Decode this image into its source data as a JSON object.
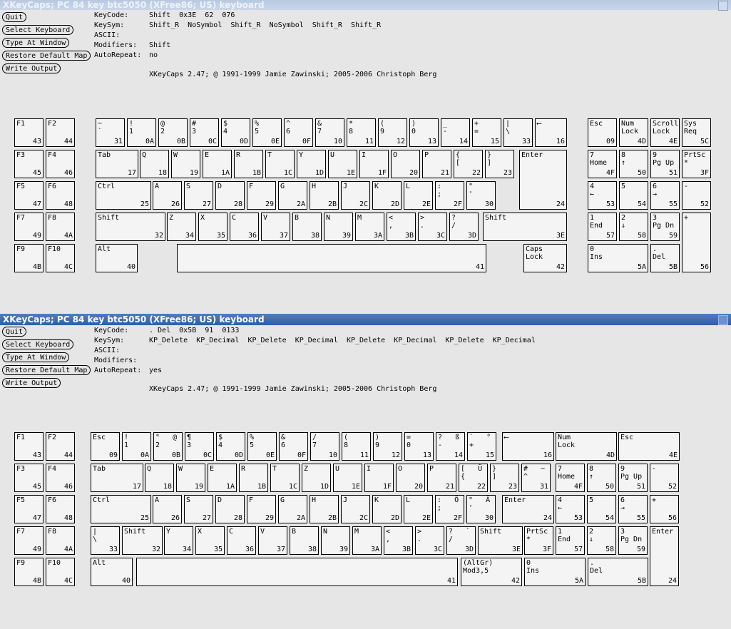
{
  "window1": {
    "title": "XKeyCaps; PC 84 key btc5050 (XFree86; US) keyboard",
    "buttons": [
      "Quit",
      "Select Keyboard",
      "Type At Window",
      "Restore Default Map",
      "Write Output"
    ],
    "info": {
      "keycode_label": "KeyCode:",
      "keycode_value": "Shift  0x3E  62  076",
      "keysym_label": "KeySym:",
      "keysym_value": "Shift_R  NoSymbol  Shift_R  NoSymbol  Shift_R  Shift_R",
      "ascii_label": "ASCII:",
      "ascii_value": "",
      "modifiers_label": "Modifiers:",
      "modifiers_value": "Shift",
      "autorepeat_label": "AutoRepeat:",
      "autorepeat_value": "no"
    },
    "copyright": "XKeyCaps 2.47; @ 1991-1999 Jamie Zawinski; 2005-2006 Christoph Berg",
    "keys": [
      {
        "t": "F1",
        "c": "43"
      },
      {
        "t": "F2",
        "c": "44"
      },
      {
        "t": "F3",
        "c": "45"
      },
      {
        "t": "F4",
        "c": "46"
      },
      {
        "t": "F5",
        "c": "47"
      },
      {
        "t": "F6",
        "c": "48"
      },
      {
        "t": "F7",
        "c": "49"
      },
      {
        "t": "F8",
        "c": "4A"
      },
      {
        "t": "F9",
        "c": "4B"
      },
      {
        "t": "F10",
        "c": "4C"
      },
      {
        "t": "~\n`",
        "c": "31"
      },
      {
        "t": "!\n1",
        "c": "0A"
      },
      {
        "t": "@\n2",
        "c": "0B"
      },
      {
        "t": "#\n3",
        "c": "0C"
      },
      {
        "t": "$\n4",
        "c": "0D"
      },
      {
        "t": "%\n5",
        "c": "0E"
      },
      {
        "t": "^\n6",
        "c": "0F"
      },
      {
        "t": "&\n7",
        "c": "10"
      },
      {
        "t": "*\n8",
        "c": "11"
      },
      {
        "t": "(\n9",
        "c": "12"
      },
      {
        "t": ")\n0",
        "c": "13"
      },
      {
        "t": "_\n-",
        "c": "14"
      },
      {
        "t": "+\n=",
        "c": "15"
      },
      {
        "t": "|\n\\",
        "c": "33"
      },
      {
        "t": "⟵",
        "c": "16"
      },
      {
        "t": "Tab",
        "c": "17"
      },
      {
        "t": "Q",
        "c": "18"
      },
      {
        "t": "W",
        "c": "19"
      },
      {
        "t": "E",
        "c": "1A"
      },
      {
        "t": "R",
        "c": "1B"
      },
      {
        "t": "T",
        "c": "1C"
      },
      {
        "t": "Y",
        "c": "1D"
      },
      {
        "t": "U",
        "c": "1E"
      },
      {
        "t": "I",
        "c": "1F"
      },
      {
        "t": "O",
        "c": "20"
      },
      {
        "t": "P",
        "c": "21"
      },
      {
        "t": "{\n[",
        "c": "22"
      },
      {
        "t": "}\n]",
        "c": "23"
      },
      {
        "t": "Enter",
        "c": "24"
      },
      {
        "t": "Ctrl",
        "c": "25"
      },
      {
        "t": "A",
        "c": "26"
      },
      {
        "t": "S",
        "c": "27"
      },
      {
        "t": "D",
        "c": "28"
      },
      {
        "t": "F",
        "c": "29"
      },
      {
        "t": "G",
        "c": "2A"
      },
      {
        "t": "H",
        "c": "2B"
      },
      {
        "t": "J",
        "c": "2C"
      },
      {
        "t": "K",
        "c": "2D"
      },
      {
        "t": "L",
        "c": "2E"
      },
      {
        "t": ":\n;",
        "c": "2F"
      },
      {
        "t": "\"\n'",
        "c": "30"
      },
      {
        "t": "Shift",
        "c": "32"
      },
      {
        "t": "Z",
        "c": "34"
      },
      {
        "t": "X",
        "c": "35"
      },
      {
        "t": "C",
        "c": "36"
      },
      {
        "t": "V",
        "c": "37"
      },
      {
        "t": "B",
        "c": "38"
      },
      {
        "t": "N",
        "c": "39"
      },
      {
        "t": "M",
        "c": "3A"
      },
      {
        "t": "<\n,",
        "c": "3B"
      },
      {
        "t": ">\n.",
        "c": "3C"
      },
      {
        "t": "?\n/",
        "c": "3D"
      },
      {
        "t": "Shift",
        "c": "3E"
      },
      {
        "t": "Alt",
        "c": "40"
      },
      {
        "t": "",
        "c": "41"
      },
      {
        "t": "Caps\nLock",
        "c": "42"
      },
      {
        "t": "Esc",
        "c": "09"
      },
      {
        "t": "Num\nLock",
        "c": "4D"
      },
      {
        "t": "Scroll\nLock",
        "c": "4E"
      },
      {
        "t": "Sys\nReq",
        "c": "5C"
      },
      {
        "t": "7\nHome",
        "c": "4F"
      },
      {
        "t": "8\n↑",
        "c": "50"
      },
      {
        "t": "9\nPg Up",
        "c": "51"
      },
      {
        "t": "PrtSc\n*",
        "c": "3F"
      },
      {
        "t": "4\n←",
        "c": "53"
      },
      {
        "t": "5",
        "c": "54"
      },
      {
        "t": "6\n→",
        "c": "55"
      },
      {
        "t": "-",
        "c": "52"
      },
      {
        "t": "1\nEnd",
        "c": "57"
      },
      {
        "t": "2\n↓",
        "c": "58"
      },
      {
        "t": "3\nPg Dn",
        "c": "59"
      },
      {
        "t": "+",
        "c": "56"
      },
      {
        "t": "0\nIns",
        "c": "5A"
      },
      {
        "t": ".\nDel",
        "c": "5B"
      }
    ]
  },
  "window2": {
    "title": "XKeyCaps; PC 84 key btc5050 (XFree86; US) keyboard",
    "buttons": [
      "Quit",
      "Select Keyboard",
      "Type At Window",
      "Restore Default Map",
      "Write Output"
    ],
    "info": {
      "keycode_label": "KeyCode:",
      "keycode_value": ". Del  0x5B  91  0133",
      "keysym_label": "KeySym:",
      "keysym_value": "KP_Delete  KP_Decimal  KP_Delete  KP_Decimal  KP_Delete  KP_Decimal  KP_Delete  KP_Decimal",
      "ascii_label": "ASCII:",
      "ascii_value": "",
      "modifiers_label": "Modifiers:",
      "modifiers_value": "",
      "autorepeat_label": "AutoRepeat:",
      "autorepeat_value": "yes"
    },
    "copyright": "XKeyCaps 2.47; @ 1991-1999 Jamie Zawinski; 2005-2006 Christoph Berg",
    "keys": [
      {
        "t": "F1",
        "c": "43"
      },
      {
        "t": "F2",
        "c": "44"
      },
      {
        "t": "F3",
        "c": "45"
      },
      {
        "t": "F4",
        "c": "46"
      },
      {
        "t": "F5",
        "c": "47"
      },
      {
        "t": "F6",
        "c": "48"
      },
      {
        "t": "F7",
        "c": "49"
      },
      {
        "t": "F8",
        "c": "4A"
      },
      {
        "t": "F9",
        "c": "4B"
      },
      {
        "t": "F10",
        "c": "4C"
      },
      {
        "t": "Esc",
        "c": "09"
      },
      {
        "t": "!\n1",
        "c": "0A"
      },
      {
        "t": "\"   @\n2",
        "c": "0B"
      },
      {
        "t": "¶\n3",
        "c": "0C"
      },
      {
        "t": "$\n4",
        "c": "0D"
      },
      {
        "t": "%\n5",
        "c": "0E"
      },
      {
        "t": "&\n6",
        "c": "0F"
      },
      {
        "t": "/\n7",
        "c": "10"
      },
      {
        "t": "(\n8",
        "c": "11"
      },
      {
        "t": ")\n9",
        "c": "12"
      },
      {
        "t": "=\n0",
        "c": "13"
      },
      {
        "t": "?   ß\n-",
        "c": "14"
      },
      {
        "t": "`   °\n+",
        "c": "15"
      },
      {
        "t": "⟵",
        "c": "16"
      },
      {
        "t": "Num\nLock",
        "c": "4D"
      },
      {
        "t": "Esc",
        "c": "4E"
      },
      {
        "t": "Tab",
        "c": "17"
      },
      {
        "t": "Q",
        "c": "18"
      },
      {
        "t": "W",
        "c": "19"
      },
      {
        "t": "E",
        "c": "1A"
      },
      {
        "t": "R",
        "c": "1B"
      },
      {
        "t": "T",
        "c": "1C"
      },
      {
        "t": "Z",
        "c": "1D"
      },
      {
        "t": "U",
        "c": "1E"
      },
      {
        "t": "I",
        "c": "1F"
      },
      {
        "t": "O",
        "c": "20"
      },
      {
        "t": "P",
        "c": "21"
      },
      {
        "t": "[   Ü\n{",
        "c": "22"
      },
      {
        "t": "}\n]",
        "c": "23"
      },
      {
        "t": "#   ~\n^",
        "c": "31"
      },
      {
        "t": "7\nHome",
        "c": "4F"
      },
      {
        "t": "8\n↑",
        "c": "50"
      },
      {
        "t": "9\nPg Up",
        "c": "51"
      },
      {
        "t": "-",
        "c": "52"
      },
      {
        "t": "Ctrl",
        "c": "25"
      },
      {
        "t": "A",
        "c": "26"
      },
      {
        "t": "S",
        "c": "27"
      },
      {
        "t": "D",
        "c": "28"
      },
      {
        "t": "F",
        "c": "29"
      },
      {
        "t": "G",
        "c": "2A"
      },
      {
        "t": "H",
        "c": "2B"
      },
      {
        "t": "J",
        "c": "2C"
      },
      {
        "t": "K",
        "c": "2D"
      },
      {
        "t": "L",
        "c": "2E"
      },
      {
        "t": ":   Ö\n;",
        "c": "2F"
      },
      {
        "t": "\"   Ä\n'",
        "c": "30"
      },
      {
        "t": "Enter",
        "c": "24"
      },
      {
        "t": "4\n←",
        "c": "53"
      },
      {
        "t": "5",
        "c": "54"
      },
      {
        "t": "6\n→",
        "c": "55"
      },
      {
        "t": "+",
        "c": "56"
      },
      {
        "t": "|\n\\",
        "c": "33"
      },
      {
        "t": "Shift",
        "c": "32"
      },
      {
        "t": "Y",
        "c": "34"
      },
      {
        "t": "X",
        "c": "35"
      },
      {
        "t": "C",
        "c": "36"
      },
      {
        "t": "V",
        "c": "37"
      },
      {
        "t": "B",
        "c": "38"
      },
      {
        "t": "N",
        "c": "39"
      },
      {
        "t": "M",
        "c": "3A"
      },
      {
        "t": "<\n,",
        "c": "3B"
      },
      {
        "t": ">\n.",
        "c": "3C"
      },
      {
        "t": "?   `\n/",
        "c": "3D"
      },
      {
        "t": "Shift",
        "c": "3E"
      },
      {
        "t": "PrtSc\n*",
        "c": "3F"
      },
      {
        "t": "1\nEnd",
        "c": "57"
      },
      {
        "t": "2\n↓",
        "c": "58"
      },
      {
        "t": "3\nPg Dn",
        "c": "59"
      },
      {
        "t": "Enter",
        "c": "24"
      },
      {
        "t": "Alt",
        "c": "40"
      },
      {
        "t": "",
        "c": "41"
      },
      {
        "t": "(AltGr)\nMod3,5",
        "c": "42"
      },
      {
        "t": "0\nIns",
        "c": "5A"
      },
      {
        "t": ".\nDel",
        "c": "5B"
      }
    ]
  }
}
